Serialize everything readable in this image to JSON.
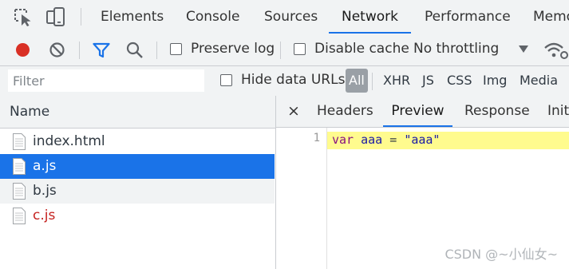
{
  "devtools": {
    "main_tabs": [
      {
        "label": "Elements",
        "active": false
      },
      {
        "label": "Console",
        "active": false
      },
      {
        "label": "Sources",
        "active": false
      },
      {
        "label": "Network",
        "active": true
      },
      {
        "label": "Performance",
        "active": false
      },
      {
        "label": "Memo",
        "active": false
      }
    ],
    "icons": {
      "inspect": "inspect-element-icon",
      "device": "device-toolbar-icon",
      "record": "record-icon",
      "clear": "clear-icon",
      "filter": "filter-icon",
      "search": "search-icon",
      "dropdown": "chevron-down-icon",
      "wifi": "network-conditions-icon",
      "close": "close-icon",
      "file": "document-file-icon"
    },
    "toolbar": {
      "preserve_log": "Preserve log",
      "preserve_log_checked": false,
      "disable_cache": "Disable cache",
      "disable_cache_checked": false,
      "throttling": "No throttling"
    },
    "filter": {
      "placeholder": "Filter",
      "hide_data_urls": "Hide data URLs",
      "hide_data_urls_checked": false,
      "types": [
        {
          "label": "All",
          "active": true
        },
        {
          "label": "XHR",
          "active": false
        },
        {
          "label": "JS",
          "active": false
        },
        {
          "label": "CSS",
          "active": false
        },
        {
          "label": "Img",
          "active": false
        },
        {
          "label": "Media",
          "active": false
        }
      ]
    },
    "requests": {
      "header": "Name",
      "items": [
        {
          "name": "index.html",
          "selected": false,
          "error": false
        },
        {
          "name": "a.js",
          "selected": true,
          "error": false
        },
        {
          "name": "b.js",
          "selected": false,
          "error": false
        },
        {
          "name": "c.js",
          "selected": false,
          "error": true
        }
      ]
    },
    "details": {
      "close_glyph": "×",
      "tabs": [
        {
          "label": "Headers",
          "active": false
        },
        {
          "label": "Preview",
          "active": true
        },
        {
          "label": "Response",
          "active": false
        },
        {
          "label": "Init",
          "active": false
        }
      ],
      "preview": {
        "line_number": "1",
        "code": {
          "kw": "var",
          "ident": "aaa",
          "op": "=",
          "str": "\"aaa\""
        }
      }
    }
  },
  "watermark": "CSDN @~小仙女~",
  "colors": {
    "accent": "#1a73e8",
    "record": "#d93025",
    "selected_row": "#1a73e8",
    "error_text": "#c5221f",
    "highlight": "#fffb8e",
    "code_keyword": "#881280",
    "code_ident": "#1a1aa6",
    "code_string": "#1a1aa6"
  }
}
